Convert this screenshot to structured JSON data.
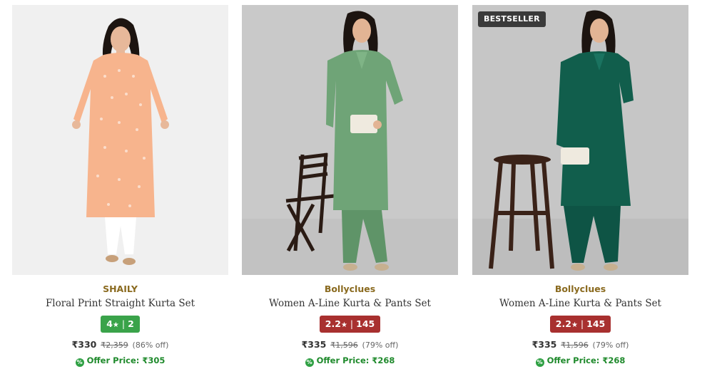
{
  "colors": {
    "brand_text": "#8a6a1f",
    "rating_good": "#3aa34a",
    "rating_poor": "#a8302f",
    "offer_green": "#1f8a2c",
    "badge_bg": "#3a3a3a"
  },
  "products": [
    {
      "badge": "",
      "brand": "SHAILY",
      "title": "Floral Print Straight Kurta Set",
      "rating": "4",
      "star": "★",
      "rating_count": "2",
      "rating_color": "#3aa34a",
      "price": "₹330",
      "mrp": "₹2,359",
      "discount": "(86% off)",
      "offer_price": "Offer Price: ₹305",
      "image_icon": "product-image"
    },
    {
      "badge": "",
      "brand": "Bollyclues",
      "title": "Women A-Line Kurta & Pants Set",
      "rating": "2.2",
      "star": "★",
      "rating_count": "145",
      "rating_color": "#a8302f",
      "price": "₹335",
      "mrp": "₹1,596",
      "discount": "(79% off)",
      "offer_price": "Offer Price: ₹268",
      "image_icon": "product-image"
    },
    {
      "badge": "BESTSELLER",
      "brand": "Bollyclues",
      "title": "Women A-Line Kurta & Pants Set",
      "rating": "2.2",
      "star": "★",
      "rating_count": "145",
      "rating_color": "#a8302f",
      "price": "₹335",
      "mrp": "₹1,596",
      "discount": "(79% off)",
      "offer_price": "Offer Price: ₹268",
      "image_icon": "product-image"
    }
  ]
}
